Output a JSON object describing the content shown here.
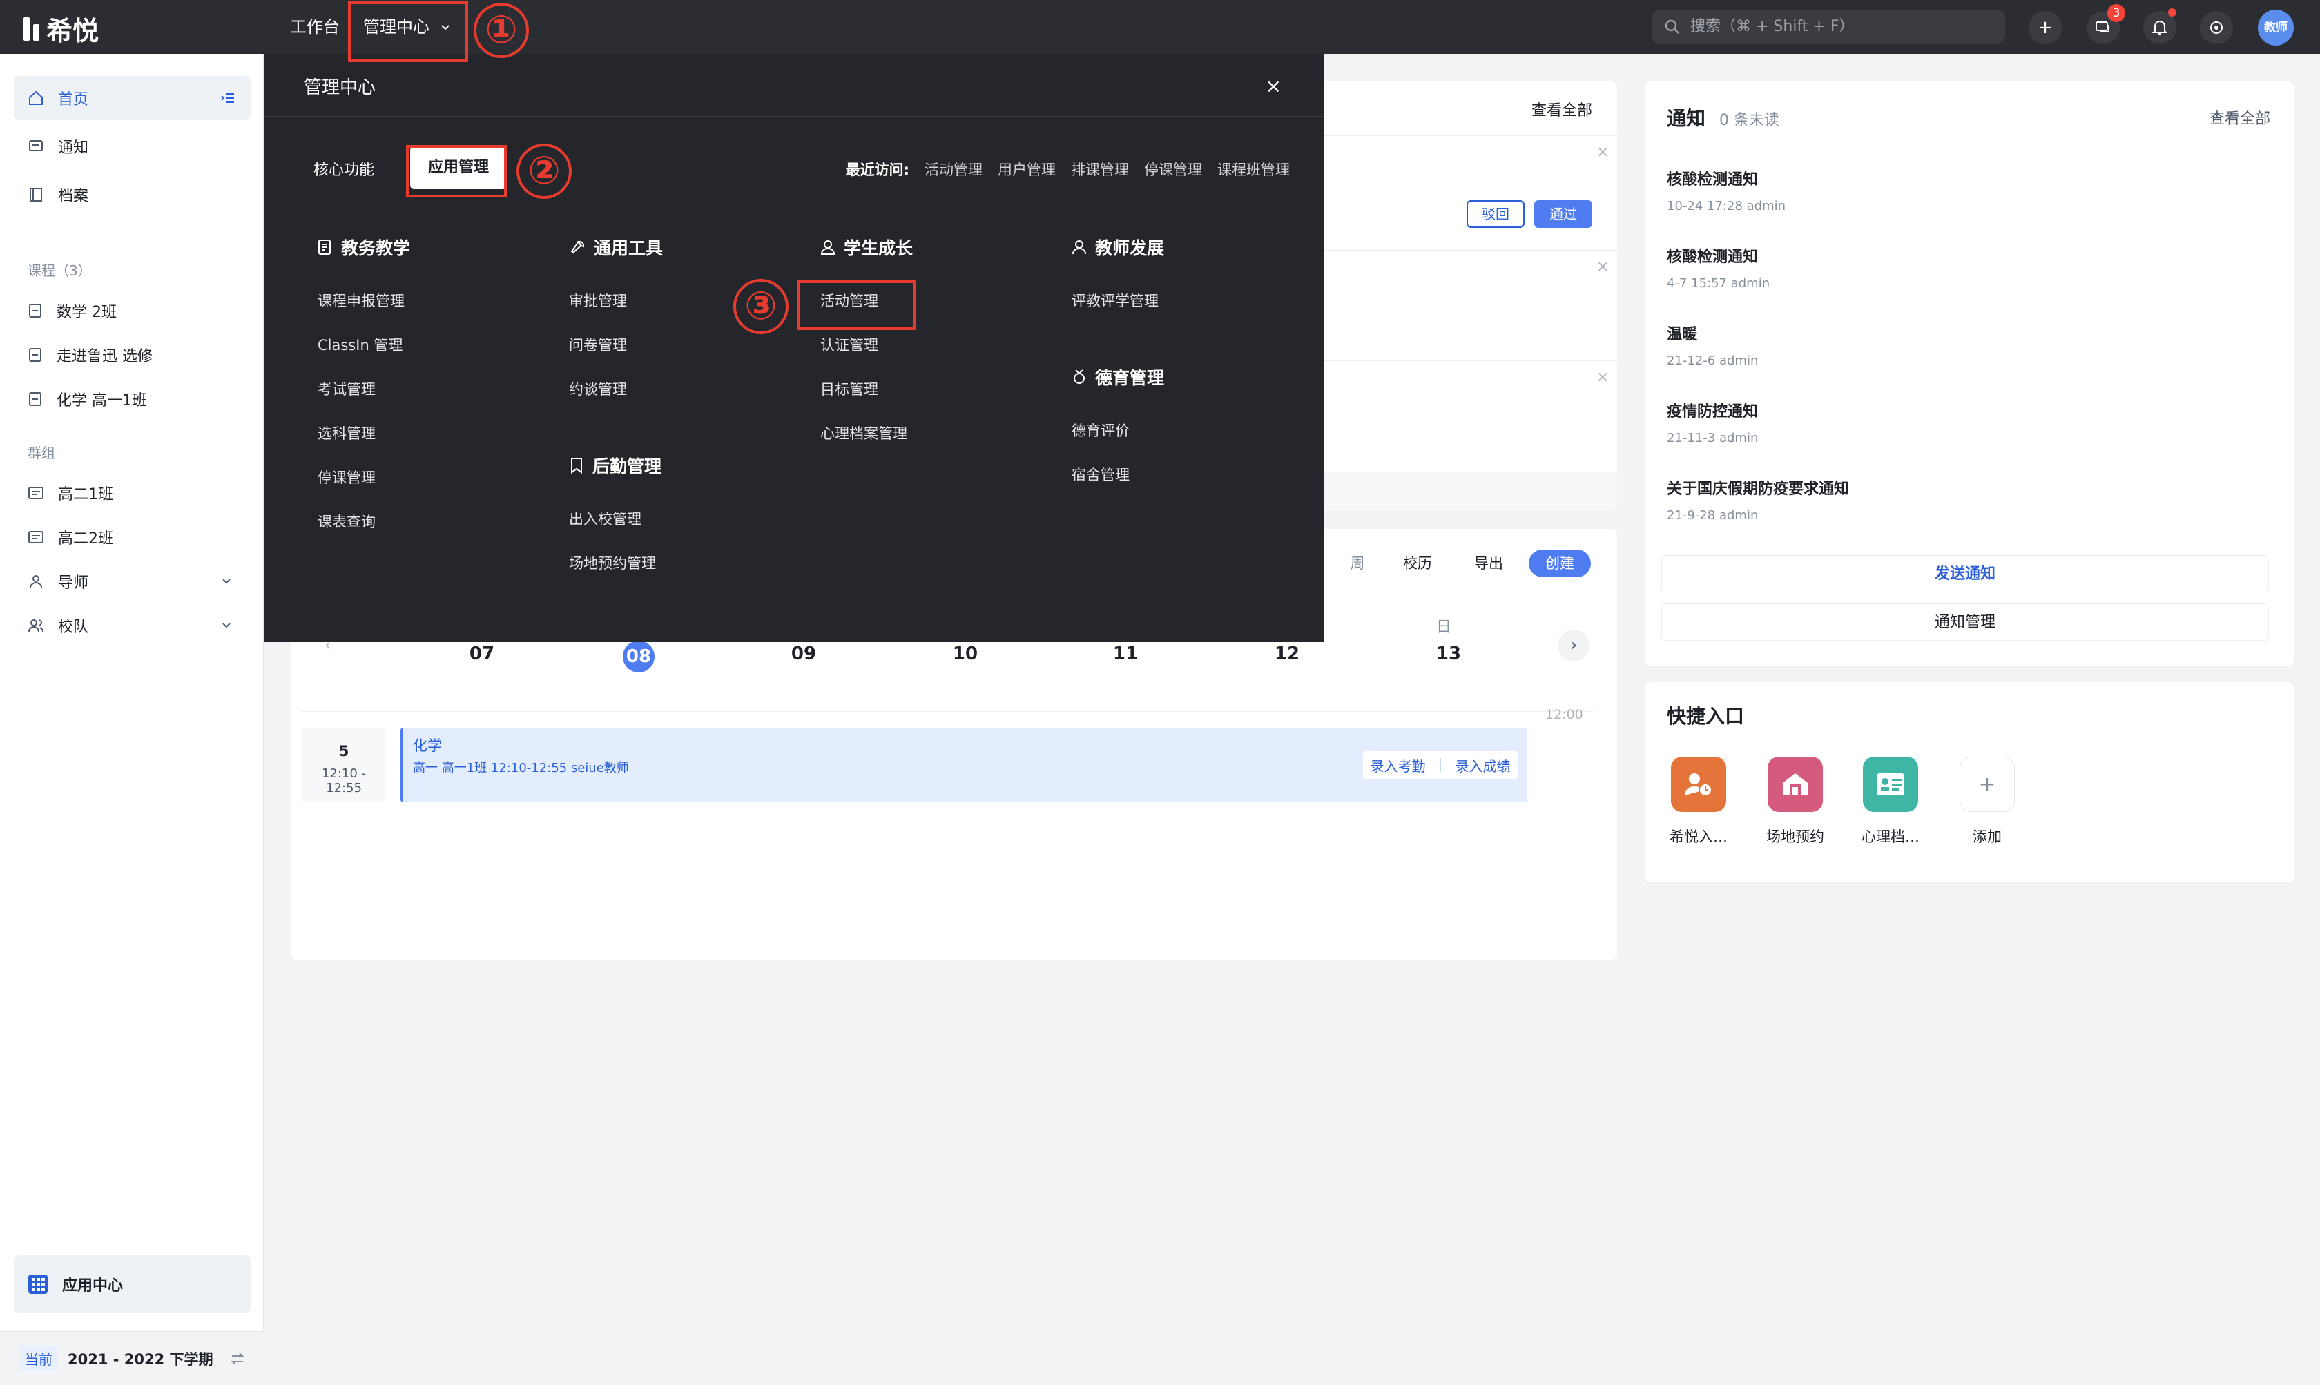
{
  "header": {
    "brand": "希悦",
    "nav_workbench": "工作台",
    "nav_admin": "管理中心",
    "search_placeholder": "搜索（⌘ + Shift + F）",
    "message_badge": "3",
    "avatar_text": "教师",
    "icons": [
      "plus-icon",
      "message-icon",
      "bell-icon",
      "settings-icon"
    ]
  },
  "sidebar": {
    "home": "首页",
    "notice": "通知",
    "archive": "档案",
    "courses_section": "课程（3）",
    "courses": [
      "数学 2班",
      "走进鲁迅 选修",
      "化学 高一1班"
    ],
    "groups_section": "群组",
    "groups": [
      "高二1班",
      "高二2班"
    ],
    "mentor": "导师",
    "team": "校队",
    "app_center": "应用中心",
    "term_current": "当前",
    "term_label": "2021 - 2022 下学期"
  },
  "middle": {
    "view_all": "查看全部",
    "reject": "驳回",
    "approve": "通过",
    "toolbar": {
      "week": "周",
      "calendar": "校历",
      "export": "导出",
      "create": "创建"
    },
    "weekday_sun": "日",
    "days": [
      "07",
      "08",
      "09",
      "10",
      "11",
      "12",
      "13"
    ],
    "time_mark": "12:00",
    "period_num": "5",
    "period_time": "12:10 - 12:55",
    "event": {
      "title": "化学",
      "detail": "高一  高一1班  12:10-12:55  seiue教师",
      "attendance": "录入考勤",
      "grades": "录入成绩"
    }
  },
  "notices": {
    "title": "通知",
    "unread": "0 条未读",
    "view_all": "查看全部",
    "items": [
      {
        "title": "核酸检测通知",
        "meta": "10-24 17:28  admin"
      },
      {
        "title": "核酸检测通知",
        "meta": "4-7 15:57  admin"
      },
      {
        "title": "温暖",
        "meta": "21-12-6  admin"
      },
      {
        "title": "疫情防控通知",
        "meta": "21-11-3  admin"
      },
      {
        "title": "关于国庆假期防疫要求通知",
        "meta": "21-9-28  admin"
      }
    ],
    "send": "发送通知",
    "manage": "通知管理"
  },
  "quick": {
    "title": "快捷入口",
    "items": [
      "希悦入…",
      "场地预约",
      "心理档…",
      "添加"
    ],
    "colors": [
      "#e5743a",
      "#d45a7e",
      "#3fb5a6",
      "#ffffff"
    ]
  },
  "admin_panel": {
    "title": "管理中心",
    "tab_core": "核心功能",
    "tab_apps": "应用管理",
    "recent_label": "最近访问:",
    "recent": [
      "活动管理",
      "用户管理",
      "排课管理",
      "停课管理",
      "课程班管理"
    ],
    "col1": {
      "title": "教务教学",
      "items": [
        "课程申报管理",
        "ClassIn 管理",
        "考试管理",
        "选科管理",
        "停课管理",
        "课表查询"
      ]
    },
    "col2": {
      "title": "通用工具",
      "items": [
        "审批管理",
        "问卷管理",
        "约谈管理"
      ]
    },
    "col2b": {
      "title": "后勤管理",
      "items": [
        "出入校管理",
        "场地预约管理"
      ]
    },
    "col3": {
      "title": "学生成长",
      "items": [
        "活动管理",
        "认证管理",
        "目标管理",
        "心理档案管理"
      ]
    },
    "col4": {
      "title": "教师发展",
      "items": [
        "评教评学管理"
      ]
    },
    "col4b": {
      "title": "德育管理",
      "items": [
        "德育评价",
        "宿舍管理"
      ]
    }
  },
  "annotations": {
    "step1": "①",
    "step2": "②",
    "step3": "③",
    "color": "#e83b2f"
  }
}
